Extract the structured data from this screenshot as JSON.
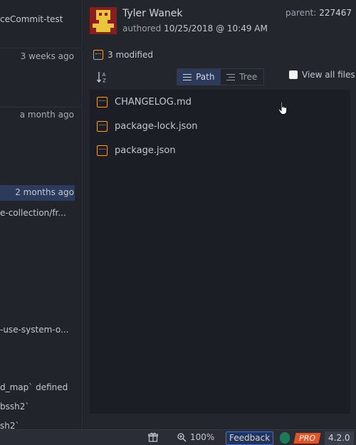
{
  "left_panel": {
    "repo_fragment": "ceCommit-test",
    "times": [
      "3 weeks ago",
      "a month ago",
      "2 months ago"
    ],
    "messages": [
      "e-collection/fr...",
      "-use-system-o...",
      "d_map` defined",
      "bssh2`",
      "sh2`"
    ]
  },
  "commit": {
    "author": "Tyler Wanek",
    "authored_label": "authored",
    "authored_date": "10/25/2018 @ 10:49 AM",
    "parent_label": "parent:",
    "parent_sha": "227467",
    "modified_count": "3 modified"
  },
  "view": {
    "path_label": "Path",
    "tree_label": "Tree",
    "view_all_label": "View all files",
    "view_all_checked": false
  },
  "files": [
    {
      "name": "CHANGELOG.md",
      "icon": "modified-file-icon"
    },
    {
      "name": "package-lock.json",
      "icon": "modified-file-icon"
    },
    {
      "name": "package.json",
      "icon": "modified-file-icon"
    }
  ],
  "status_bar": {
    "zoom": "100%",
    "feedback": "Feedback",
    "pro": "PRO",
    "version": "4.2.0"
  },
  "colors": {
    "accent_selected": "#2c3b5c",
    "modified_icon": "#e3a24a",
    "pro_badge": "#e0542a",
    "avatar_bg": "#8a1d1d",
    "avatar_fg": "#e8c53a"
  }
}
